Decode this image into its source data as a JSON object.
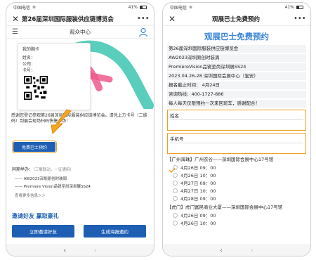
{
  "status": {
    "carrier": "中国电信",
    "battery": "41%"
  },
  "left": {
    "title": "第26届深圳国际服装供应链博览会",
    "subnav_title": "观众中心",
    "badge": {
      "title": "我的胸卡",
      "name_label": "姓名：",
      "company_label": "公司：",
      "card_label": "卡号："
    },
    "notice": "感谢您登记参观第26届深圳国际服装供应链博览会。请凭上方卡号（二维码）到展会现场扫码快捷入场！",
    "bus_button": "免费巴士预约",
    "sync_title": "同期举办：",
    "sync_note": "（三展联动，一证通用）",
    "sync_items": [
      "—— AW2023深圳原创时装周",
      "—— Premiere Vision品锐至尚深圳展SS24"
    ],
    "more": "查看更多信息＞＞",
    "invite_title": "邀请好友 赢取豪礼",
    "invite_btn1": "立即邀请好友",
    "invite_btn2": "生成海报邀约"
  },
  "right": {
    "title": "观展巴士免费预约",
    "heading": "观展巴士免费预约",
    "info_rows": [
      "第26届深圳国际服装供应链博览会",
      "AW2023深圳原创时装周",
      "PremièreVision品锐至尚深圳展SS24",
      "2023.04.26-28 深圳国际会展中心（宝安）",
      "报名截止时间： 4月24日",
      "咨询热线：400-1727-886",
      "每人每天仅限预约一次来回班车，感谢配合！"
    ],
    "name_label": "姓名",
    "phone_label": "手机号",
    "route1": "【广州海珠】广州衣谷——深圳国际会展中心17号馆",
    "route1_slots": [
      "4月26日 09：00",
      "4月26日 10：00",
      "4月27日 09：00",
      "4月27日 10：00",
      "4月28日 09：00"
    ],
    "route2": "【虎门】虎门富民商业大厦——深圳国际会展中心17号馆",
    "route2_slots": [
      "4月26日 09：00",
      "4月26日 10：00"
    ]
  },
  "nav": {
    "back": "‹",
    "forward": "›"
  },
  "colors": {
    "primary": "#1e5fb4",
    "heading": "#3a86d8",
    "highlight": "#f0a020",
    "accent_pink": "#ef5a8c",
    "accent_teal": "#3cc6b0"
  }
}
